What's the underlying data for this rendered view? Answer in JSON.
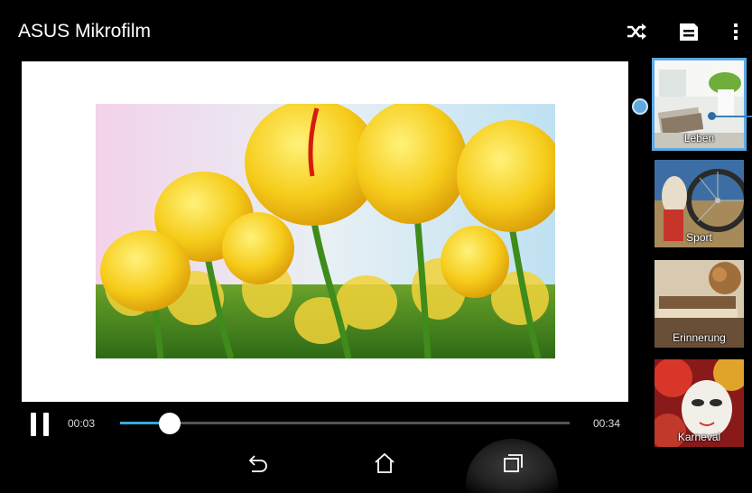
{
  "app": {
    "title": "ASUS Mikrofilm"
  },
  "toolbar": {
    "shuffle_icon": "shuffle-icon",
    "save_icon": "save-icon",
    "more_icon": "more-vert-icon"
  },
  "player": {
    "current_time": "00:03",
    "total_time": "00:34",
    "progress": 0.11,
    "pause_icon": "pause-icon"
  },
  "themes": [
    {
      "label": "Leben",
      "selected": true
    },
    {
      "label": "Sport",
      "selected": false
    },
    {
      "label": "Erinnerung",
      "selected": false
    },
    {
      "label": "Karneval",
      "selected": false
    }
  ],
  "navbar": {
    "back_icon": "back-icon",
    "home_icon": "home-icon",
    "recents_icon": "recents-icon"
  },
  "colors": {
    "accent": "#35a8e0",
    "selection": "#5da9e3",
    "background": "#000000"
  }
}
